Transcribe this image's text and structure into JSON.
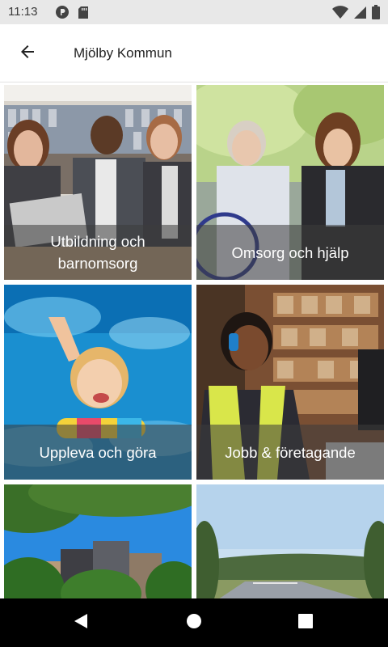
{
  "status_bar": {
    "time": "11:13",
    "left_icons": [
      "p-notification-icon",
      "sd-card-icon"
    ],
    "right_icons": [
      "wifi-icon",
      "signal-icon",
      "battery-icon"
    ]
  },
  "app_bar": {
    "back_icon": "arrow-left-icon",
    "title": "Mjölby Kommun"
  },
  "tiles": [
    {
      "label": "Utbildning och barnomsorg",
      "photo": "students-in-library"
    },
    {
      "label": "Omsorg och hjälp",
      "photo": "caregiver-with-elderly-woman"
    },
    {
      "label": "Uppleva och göra",
      "photo": "child-swimming-in-pool"
    },
    {
      "label": "Jobb & företagande",
      "photo": "warehouse-worker-with-headset"
    },
    {
      "label": "",
      "photo": "apartment-buildings-with-trees"
    },
    {
      "label": "",
      "photo": "highway-landscape"
    }
  ],
  "nav_bar": {
    "icons": [
      "back-triangle-icon",
      "home-circle-icon",
      "recents-square-icon"
    ]
  },
  "colors": {
    "status_bar_bg": "#e8e8e8",
    "app_bar_bg": "#ffffff",
    "caption_overlay": "rgba(60,60,60,0.55)",
    "nav_bar_bg": "#000000"
  }
}
